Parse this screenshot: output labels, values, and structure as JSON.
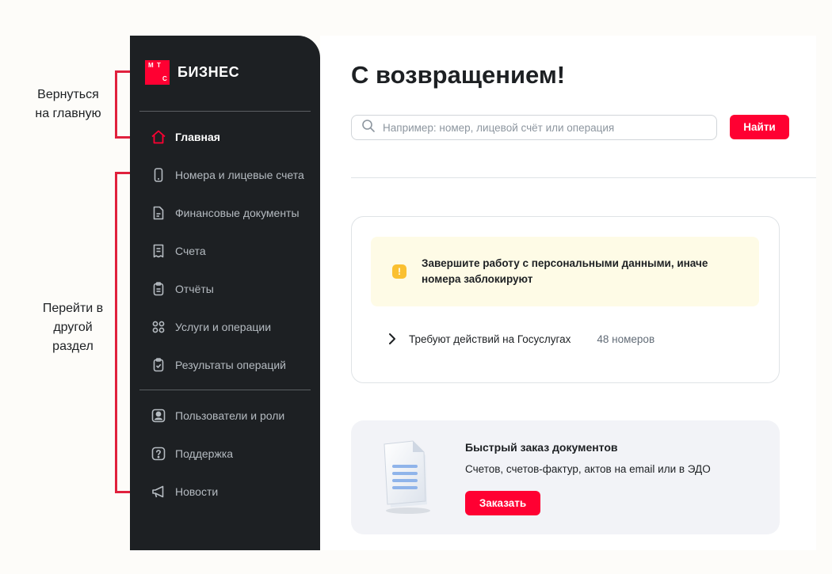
{
  "annotations": {
    "home_hint": "Вернуться на главную",
    "section_hint": "Перейти в другой раздел"
  },
  "sidebar": {
    "logo": {
      "mark_letters": [
        "М",
        "Т",
        "С"
      ],
      "text": "БИЗНЕС"
    },
    "items": [
      {
        "label": "Главная",
        "icon": "home-icon",
        "active": true
      },
      {
        "label": "Номера и лицевые счета",
        "icon": "phone-icon"
      },
      {
        "label": "Финансовые документы",
        "icon": "document-icon"
      },
      {
        "label": "Счета",
        "icon": "receipt-icon"
      },
      {
        "label": "Отчёты",
        "icon": "report-icon"
      },
      {
        "label": "Услуги и операции",
        "icon": "services-grid-icon"
      },
      {
        "label": "Результаты операций",
        "icon": "checklist-icon"
      },
      {
        "label": "Пользователи и роли",
        "icon": "user-icon"
      },
      {
        "label": "Поддержка",
        "icon": "help-icon"
      },
      {
        "label": "Новости",
        "icon": "megaphone-icon"
      }
    ]
  },
  "main": {
    "title": "С возвращением!",
    "search": {
      "placeholder": "Например: номер, лицевой счёт или операция",
      "button_label": "Найти"
    },
    "warning_card": {
      "message": "Завершите работу с персональными данными, иначе номера заблокируют",
      "icon_glyph": "!",
      "expand_label": "Требуют действий на Госуслугах",
      "expand_count": "48 номеров"
    },
    "promo_card": {
      "title": "Быстрый заказ документов",
      "subtitle": "Счетов, счетов-фактур, актов на email или в ЭДО",
      "button_label": "Заказать"
    }
  },
  "colors": {
    "accent": "#ff0032",
    "sidebar_bg": "#1d2023",
    "annotation": "#e0213d",
    "warning_bg": "#fefbe6",
    "warning_icon": "#fac031"
  }
}
